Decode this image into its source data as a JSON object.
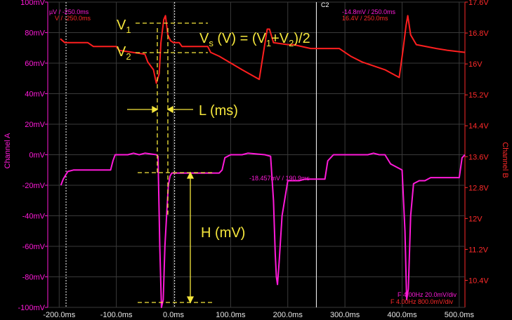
{
  "chart_data": {
    "type": "line",
    "x_axis": {
      "unit": "ms",
      "range": [
        -220,
        510
      ],
      "ticks": [
        -200,
        -100,
        0,
        100,
        200,
        300,
        400,
        500
      ],
      "tick_labels": [
        "-200.0ms",
        "-100.0ms",
        "0.0ms",
        "100.0ms",
        "200.0ms",
        "300.0ms",
        "400.0ms",
        "500.0ms"
      ]
    },
    "y_axis_left": {
      "label": "Channel A",
      "unit": "mV",
      "range": [
        -100,
        100
      ],
      "ticks": [
        100,
        80,
        60,
        40,
        20,
        0,
        -20,
        -40,
        -60,
        -80,
        -100
      ],
      "tick_labels": [
        "100mV",
        "80mV",
        "60mV",
        "40mV",
        "20mV",
        "0mV",
        "-20mV",
        "-40mV",
        "-60mV",
        "-80mV",
        "-100mV"
      ]
    },
    "y_axis_right": {
      "label": "Channel B",
      "unit": "V",
      "range": [
        9.7,
        17.6
      ],
      "ticks": [
        17.6,
        16.8,
        16.0,
        15.2,
        14.4,
        13.6,
        12.8,
        12.0,
        11.2,
        10.4
      ],
      "tick_labels": [
        "17.6V",
        "16.8V",
        "16V",
        "15.2V",
        "14.4V",
        "13.6V",
        "12.8V",
        "12V",
        "11.2V",
        "10.4V"
      ]
    },
    "grid": true,
    "series": [
      {
        "axis": "B",
        "color": "#ff1f1f",
        "x": [
          -198,
          -190,
          -150,
          -140,
          -100,
          -95,
          -50,
          -45,
          -35,
          -30,
          -25,
          -22,
          -17,
          -14,
          -10,
          -5,
          0,
          10,
          15,
          60,
          65,
          80,
          120,
          150,
          158,
          164,
          168,
          175,
          200,
          210,
          240,
          290,
          300,
          310,
          330,
          370,
          395,
          402,
          407,
          410,
          415,
          425,
          460,
          480,
          510
        ],
        "y": [
          16.65,
          16.55,
          16.55,
          16.45,
          16.45,
          16.35,
          16.25,
          16.05,
          15.85,
          15.5,
          15.75,
          16.55,
          17.15,
          17.25,
          16.75,
          16.6,
          16.55,
          16.55,
          16.45,
          16.45,
          16.3,
          16.2,
          15.85,
          15.6,
          16.35,
          16.9,
          16.9,
          16.55,
          16.5,
          16.5,
          16.4,
          16.4,
          16.3,
          16.2,
          16.05,
          15.85,
          15.65,
          16.4,
          17.0,
          17.25,
          16.75,
          16.5,
          16.4,
          16.35,
          16.3
        ]
      },
      {
        "axis": "A",
        "color": "#ff1ad9",
        "x": [
          -197,
          -193,
          -185,
          -175,
          -160,
          -110,
          -106,
          -102,
          -80,
          -70,
          -60,
          -50,
          -30,
          -27,
          -24,
          -21,
          -18,
          -15,
          -12,
          -9,
          -6,
          -3,
          0,
          20,
          70,
          80,
          85,
          90,
          100,
          110,
          120,
          130,
          160,
          170,
          175,
          178,
          180,
          182,
          185,
          190,
          200,
          220,
          230,
          240,
          250,
          265,
          270,
          280,
          300,
          340,
          350,
          360,
          370,
          380,
          400,
          405,
          408,
          411,
          415,
          420,
          430,
          440,
          450,
          460,
          470,
          480,
          500,
          505,
          510
        ],
        "y": [
          -20,
          -16,
          -11,
          -10,
          -10,
          -10,
          -4,
          0,
          0,
          1,
          0,
          1,
          0,
          -1,
          -60,
          -100,
          -95,
          -60,
          -40,
          -20,
          -14,
          -12,
          -12,
          -12,
          -12,
          -12,
          -10,
          -2,
          0,
          0,
          0,
          1,
          0,
          -1,
          -30,
          -65,
          -80,
          -85,
          -70,
          -40,
          -17,
          -17,
          -16,
          -16,
          -16,
          -16,
          -4,
          0,
          0,
          0,
          1,
          0,
          0,
          -6,
          -10,
          -50,
          -95,
          -88,
          -40,
          -19,
          -17,
          -17,
          -15,
          -15,
          -15,
          -15,
          -15,
          -2,
          0
        ]
      }
    ],
    "annotations": {
      "v1": "V",
      "v1_sub": "1",
      "v2": "V",
      "v2_sub": "2",
      "formula_left": "V",
      "formula_sub_s": "s",
      "formula_mid": " (V) = (V",
      "formula_sub_1": "1",
      "formula_plus": "+V",
      "formula_sub_2": "2",
      "formula_end": ")/2",
      "l_label": "L (ms)",
      "h_label": "H (mV)"
    },
    "cursor_labels": {
      "top_left_1": "µV / -250.0ms",
      "top_left_2": "V / -250.0ms",
      "c2": "C2",
      "top_right_1": "-14.8mV / 250.0ms",
      "top_right_2": "16.4V / 250.0ms",
      "mid": "-18.457mV / 190.9ms",
      "bottom_1": "F 4.00Hz 20.0mV/div",
      "bottom_2": "F 4.00Hz 800.0mV/div"
    }
  }
}
